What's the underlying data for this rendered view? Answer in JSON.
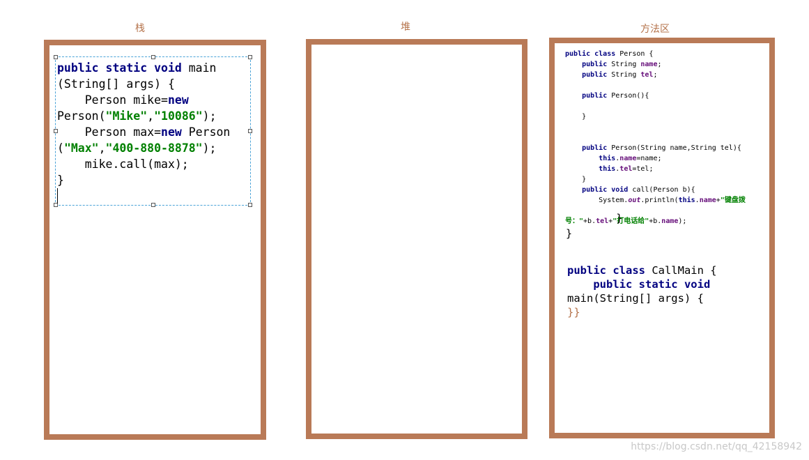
{
  "labels": {
    "stack": "栈",
    "heap": "堆",
    "method_area": "方法区"
  },
  "stack_code": [
    [
      "kw:public static void",
      " main"
    ],
    [
      "(String[] args) {"
    ],
    [
      "    Person mike=",
      "kw:new"
    ],
    [
      "Person(",
      "str:\"Mike\"",
      ",",
      "str:\"10086\"",
      ");"
    ],
    [
      "    Person max=",
      "kw:new",
      " Person"
    ],
    [
      "(",
      "str:\"Max\"",
      ",",
      "str:\"400-880-8878\"",
      ");"
    ],
    [
      "    mike.call(max);"
    ],
    [
      "}"
    ]
  ],
  "method_code_small": [
    [
      "kw:public class",
      " Person {"
    ],
    [
      "    ",
      "kw:public",
      " String ",
      "fld:name",
      ";"
    ],
    [
      "    ",
      "kw:public",
      " String ",
      "fld:tel",
      ";"
    ],
    [
      ""
    ],
    [
      "    ",
      "kw:public",
      " Person(){"
    ],
    [
      ""
    ],
    [
      "    }"
    ],
    [
      ""
    ],
    [
      ""
    ],
    [
      "    ",
      "kw:public",
      " Person(String name,String tel){"
    ],
    [
      "        ",
      "kw:this",
      ".",
      "fld:name",
      "=name;"
    ],
    [
      "        ",
      "kw:this",
      ".",
      "fld:tel",
      "=tel;"
    ],
    [
      "    }"
    ],
    [
      "    ",
      "kw:public void",
      " call(Person b){"
    ],
    [
      "        System.",
      "it:out",
      ".println(",
      "kw:this",
      ".",
      "fld:name",
      "+",
      "str:\"键盘拨"
    ],
    [
      ""
    ],
    [
      "str:号：\"",
      "+b.",
      "fld:tel",
      "+",
      "str:\"打电话给\"",
      "+b.",
      "fld:name",
      ");"
    ]
  ],
  "method_code_big": [
    [
      "        }"
    ],
    [
      "}"
    ]
  ],
  "callmain_code": [
    [
      "kw:public class",
      " CallMain {"
    ],
    [
      "    ",
      "kw:public static void"
    ],
    [
      "main(String[] args) {"
    ],
    [
      "brace:}}"
    ]
  ],
  "watermark": "https://blog.csdn.net/qq_42158942"
}
